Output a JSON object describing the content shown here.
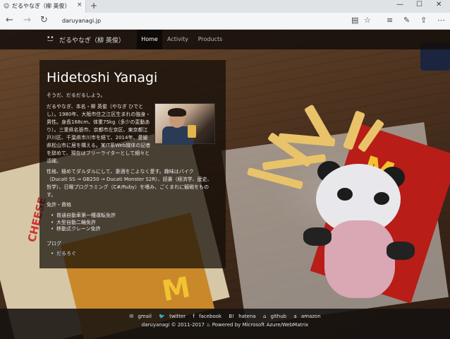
{
  "browser": {
    "tab_title": "だるやなぎ（柳 英俊）",
    "tab_close": "×",
    "new_tab": "+",
    "url": "daruyanagi.jp",
    "win_minimize": "—",
    "win_maximize": "☐",
    "win_close": "✕"
  },
  "site": {
    "brand_icon": "•͜•",
    "brand": "だるやなぎ（柳 英俊）",
    "nav": [
      "Home",
      "Activity",
      "Products"
    ],
    "active_nav": "Home"
  },
  "profile": {
    "name": "Hidetoshi Yanagi",
    "tagline": "そうだ、だるだるしよう。",
    "bio": "だるやなぎ、本名・柳 英俊（やなぎ ひでとし）。1980年、大阪市住之江区生まれの独身・男性。身長168cm、体重75kg（多少の変動あり）。三重県名張市、京都市左京区、東京都江戸川区、千葉県市川市を経て、2014年、愛媛県松山市に居を構える。某IT系Web媒体の記者を辞めて、現在はフリーライターとして細々と活躍。",
    "hobby": "性格、極めてダルダルにして、妻酒をこよなく愛す。趣味はバイク（Ducati SS → GB250 → Ducati Monster S2R）、読書（経済学、歴史、哲学）、日曜プログラミング（C#/Ruby）を嗜み、ごくまれに観戦をものす。"
  },
  "licenses": {
    "heading": "免許・資格",
    "items": [
      "普通自動車第一種運転免許",
      "大型自動二輪免許",
      "移動式クレーン免許"
    ]
  },
  "blog": {
    "heading": "ブログ",
    "items": [
      "だるろぐ"
    ]
  },
  "footer": {
    "links": [
      {
        "icon": "✉",
        "label": "gmail"
      },
      {
        "icon": "🐦",
        "label": "twitter"
      },
      {
        "icon": "f",
        "label": "facebook"
      },
      {
        "icon": "B!",
        "label": "hatena"
      },
      {
        "icon": "⌂",
        "label": "github"
      },
      {
        "icon": "a",
        "label": "amazon"
      }
    ],
    "copyright": "daruyanagi © 2011-2017 ♨ Powered by Microsoft Azure/WebMatrix"
  }
}
